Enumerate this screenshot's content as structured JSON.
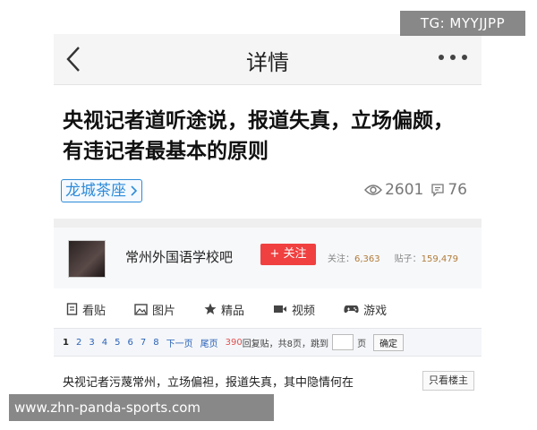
{
  "header": {
    "title": "详情"
  },
  "article": {
    "title": "央视记者道听途说，报道失真，立场偏颇，有违记者最基本的原则",
    "tag": "龙城茶座",
    "views": "2601",
    "comments": "76"
  },
  "forum": {
    "name": "常州外国语学校吧",
    "follow_label": "+ 关注",
    "followers_label": "关注：",
    "followers": "6,363",
    "posts_label": "贴子：",
    "posts": "159,479"
  },
  "tabs": [
    {
      "label": "看贴",
      "icon": "document-icon"
    },
    {
      "label": "图片",
      "icon": "image-icon"
    },
    {
      "label": "精品",
      "icon": "star-icon"
    },
    {
      "label": "视频",
      "icon": "video-icon"
    },
    {
      "label": "游戏",
      "icon": "gamepad-icon"
    }
  ],
  "pager": {
    "pages": [
      "1",
      "2",
      "3",
      "4",
      "5",
      "6",
      "7",
      "8"
    ],
    "next": "下一页",
    "last": "尾页",
    "reply_count": "390",
    "reply_suffix": "回复贴，共8页，跳到",
    "page_unit": "页",
    "ok": "确定"
  },
  "post": {
    "title": "央视记者污蔑常州，立场偏袒，报道失真，其中隐情何在",
    "host_only": "只看楼主"
  },
  "watermarks": {
    "tg": "TG: MYYJJPP",
    "url": "www.zhn-panda-sports.com"
  },
  "colors": {
    "accent_blue": "#2e8bd8",
    "follow_red": "#f04040",
    "link_blue": "#2b62b8"
  }
}
